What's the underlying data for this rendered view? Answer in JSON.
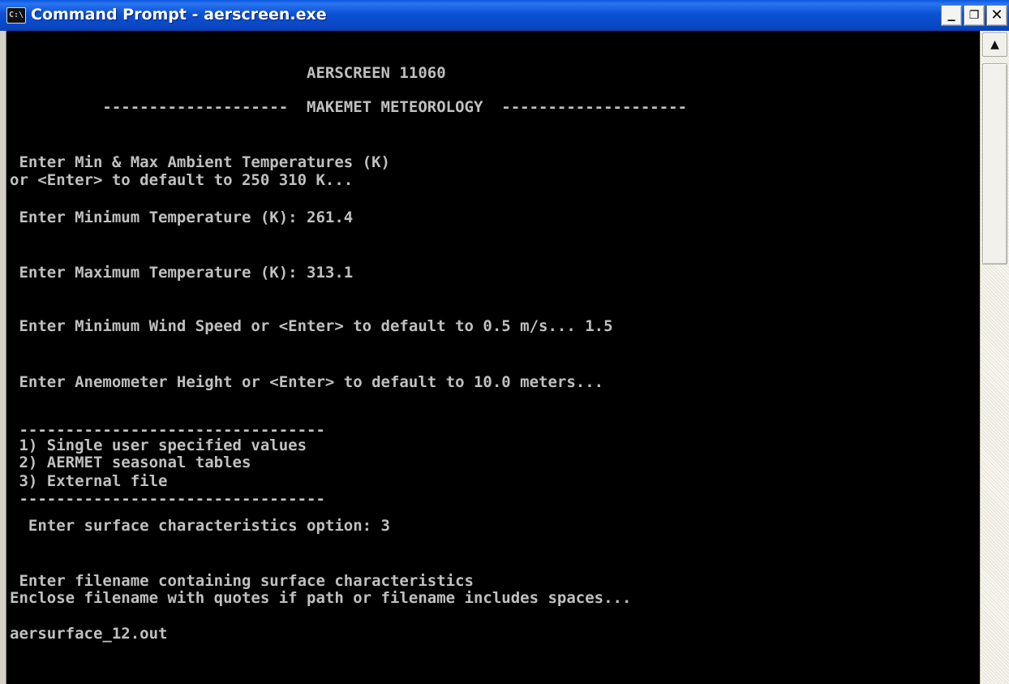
{
  "window": {
    "title": "Command Prompt - aerscreen.exe",
    "icon_text": "C:\\",
    "icon": "console-icon",
    "buttons": {
      "minimize": "minimize-icon",
      "maximize": "restore-icon",
      "close": "close-icon"
    }
  },
  "console": {
    "lines": [
      "                                AERSCREEN 11060",
      "          --------------------  MAKEMET METEOROLOGY  --------------------",
      " Enter Min & Max Ambient Temperatures (K)",
      "or <Enter> to default to 250 310 K...",
      " Enter Minimum Temperature (K): 261.4",
      " Enter Maximum Temperature (K): 313.1",
      " Enter Minimum Wind Speed or <Enter> to default to 0.5 m/s... 1.5",
      " Enter Anemometer Height or <Enter> to default to 10.0 meters...",
      " ---------------------------------",
      " 1) Single user specified values",
      " 2) AERMET seasonal tables",
      " 3) External file",
      " ---------------------------------",
      "  Enter surface characteristics option: 3",
      " Enter filename containing surface characteristics",
      "Enclose filename with quotes if path or filename includes spaces...",
      "aersurface_12.out"
    ]
  },
  "scrollbar": {
    "up_arrow": "scroll-up-arrow-icon"
  },
  "colors": {
    "console_bg": "#000000",
    "console_fg": "#c0c0c0",
    "titlebar": "#0b52d4"
  }
}
